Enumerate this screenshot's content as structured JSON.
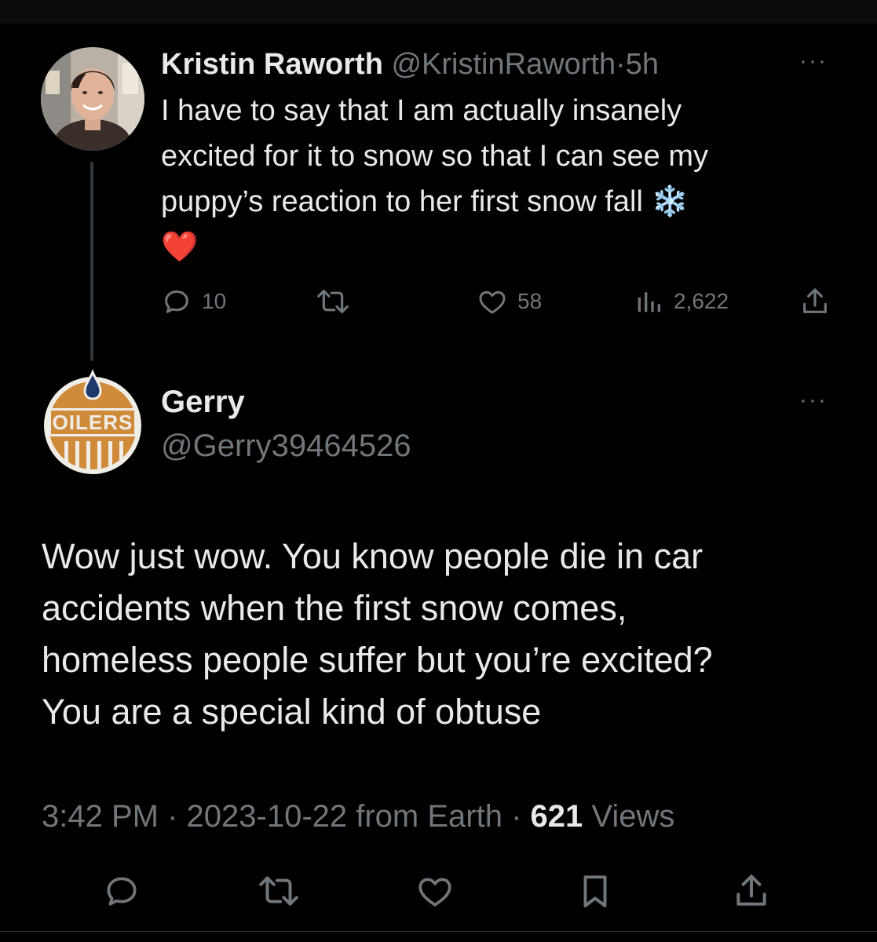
{
  "parent_tweet": {
    "display_name": "Kristin Raworth",
    "handle": "@KristinRaworth",
    "separator": "·",
    "time": "5h",
    "text_lines": [
      "I have to say that I am actually insanely",
      "excited for it to snow so that I can see my",
      "puppy’s reaction to her first snow fall ❄️",
      "❤️"
    ],
    "actions": {
      "reply_count": "10",
      "retweet_count": "",
      "like_count": "58",
      "views_count": "2,622"
    },
    "more_label": "···"
  },
  "reply_tweet": {
    "display_name": "Gerry",
    "handle": "@Gerry39464526",
    "avatar_logo_text": "OILERS",
    "text_lines": [
      "Wow just wow. You know people die in car",
      "accidents when the first snow comes,",
      "homeless people suffer but you’re excited?",
      "You are a special kind of obtuse"
    ],
    "meta": {
      "time": "3:42 PM",
      "sep1": " · ",
      "date": "2023-10-22",
      "source": " from Earth",
      "sep2": " · ",
      "views_count": "621",
      "views_label": " Views"
    },
    "more_label": "···"
  },
  "icons": {
    "reply": "reply-icon",
    "retweet": "retweet-icon",
    "like": "heart-icon",
    "views": "views-icon",
    "share": "share-icon",
    "bookmark": "bookmark-icon"
  },
  "colors": {
    "background": "#000000",
    "text_primary": "#e7e9ea",
    "text_secondary": "#71767b",
    "oilers_orange": "#cf8a3a",
    "oilers_blue": "#1e3a6a"
  }
}
